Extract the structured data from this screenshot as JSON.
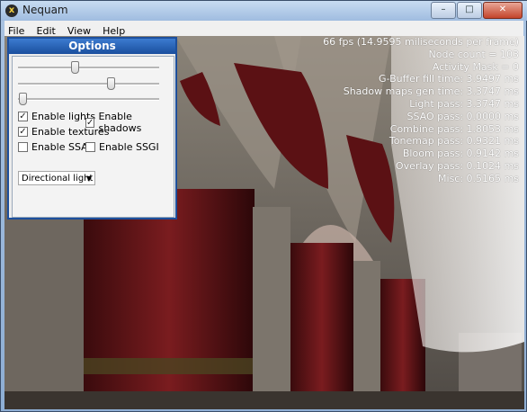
{
  "window": {
    "title": "Nequam",
    "app_icon": "x",
    "controls": {
      "minimize": "–",
      "maximize": "□",
      "close": "✕"
    }
  },
  "menu": [
    "File",
    "Edit",
    "View",
    "Help"
  ],
  "stats": [
    "66 fps (14.9595 miliseconds per frame)",
    "Node count = 103",
    "Activity Mask = 0",
    "G-Buffer fill time: 3.9497 ms",
    "Shadow maps gen time: 3.3747 ms",
    "Light pass: 3.3747 ms",
    "SSAO pass: 0.0000 ms",
    "Combine pass: 1.8053 ms",
    "Tonemap pass: 0.9321 ms",
    "Bloom pass: 0.9142 ms",
    "Overlay pass: 0.1024 ms",
    "Misc: 0.5165 ms"
  ],
  "options": {
    "title": "Options",
    "sliders": [
      0.4,
      0.67,
      0.01
    ],
    "checkboxes": [
      {
        "label": "Enable lights",
        "checked": true
      },
      {
        "label": "Enable shadows",
        "checked": true
      },
      {
        "label": "Enable textures",
        "checked": true
      },
      {
        "label": "Enable SSAO",
        "checked": false
      },
      {
        "label": "Enable SSGI",
        "checked": false
      }
    ],
    "light_type": "Directional light"
  }
}
